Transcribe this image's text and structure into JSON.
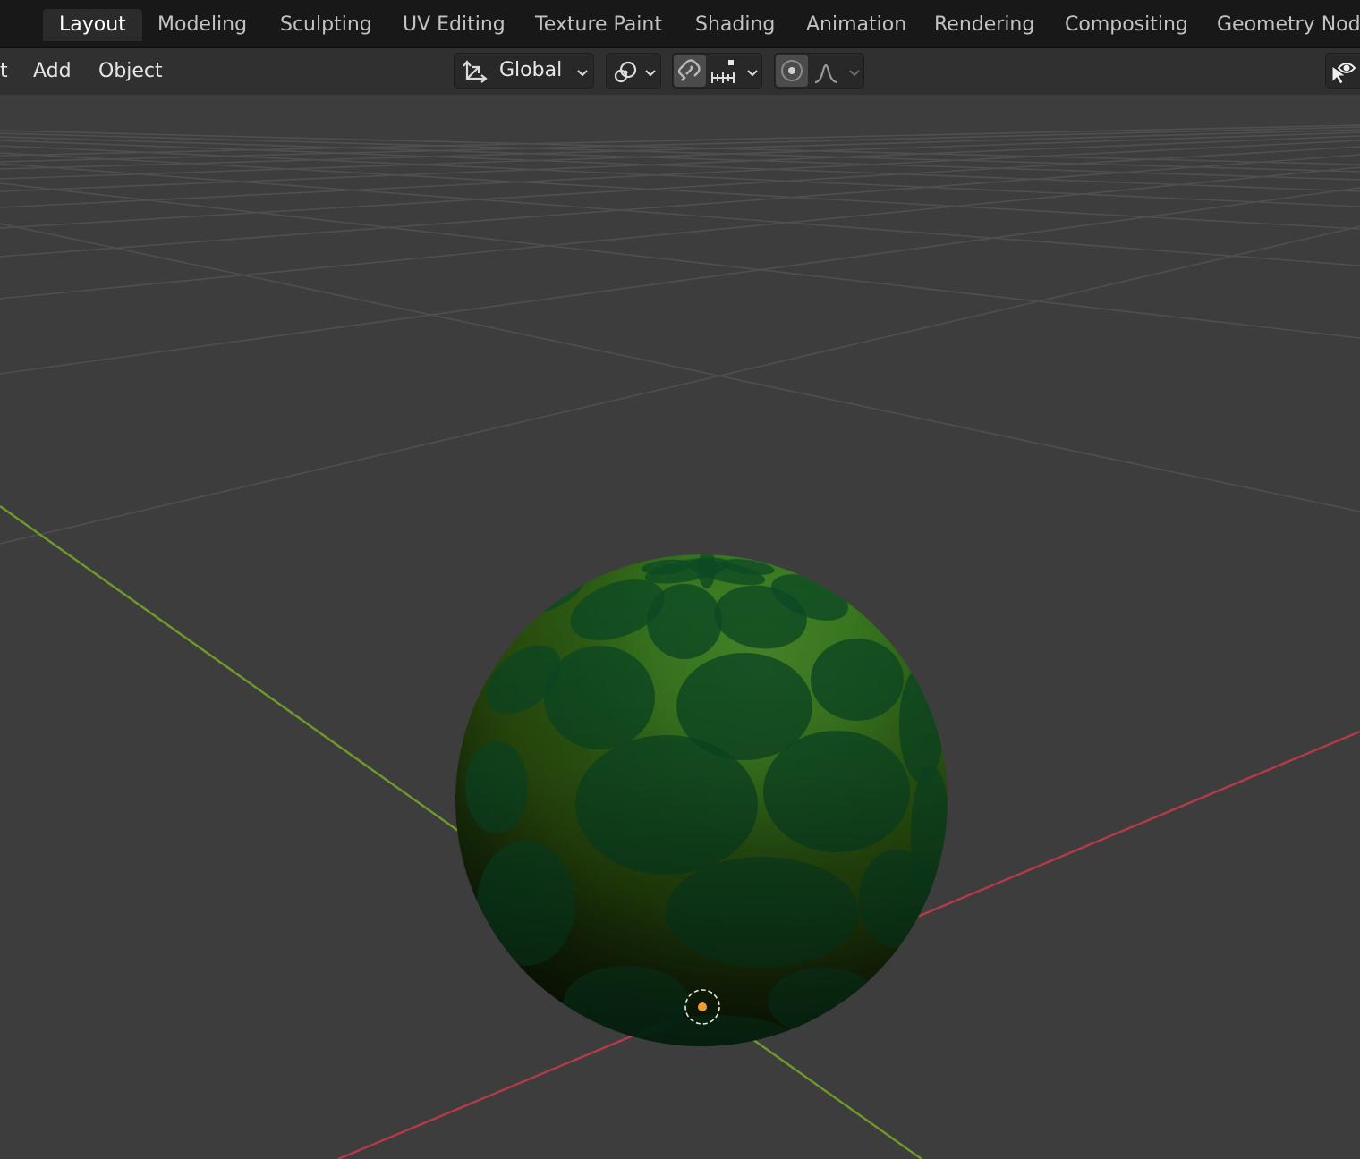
{
  "workspace_tabs": [
    {
      "label": "Layout",
      "active": true
    },
    {
      "label": "Modeling",
      "active": false
    },
    {
      "label": "Sculpting",
      "active": false
    },
    {
      "label": "UV Editing",
      "active": false
    },
    {
      "label": "Texture Paint",
      "active": false
    },
    {
      "label": "Shading",
      "active": false
    },
    {
      "label": "Animation",
      "active": false
    },
    {
      "label": "Rendering",
      "active": false
    },
    {
      "label": "Compositing",
      "active": false
    },
    {
      "label": "Geometry Node",
      "active": false
    }
  ],
  "header": {
    "menu_partial": "t",
    "menu_add": "Add",
    "menu_object": "Object",
    "transform_orientation": "Global",
    "snap_enabled": true,
    "proportional_editing_enabled": false
  },
  "icons": {
    "orientation": "transform-orientation-icon",
    "pivot": "pivot-point-icon",
    "snap": "magnet-snap-icon",
    "snap_target": "snap-increment-icon",
    "proportional": "proportional-editing-icon",
    "falloff": "falloff-curve-icon",
    "visibility": "eye-visibility-icon"
  },
  "colors": {
    "x_axis": "#b53a4a",
    "y_axis": "#6f9a2a",
    "grid": "#4f4f4f",
    "origin": "#f0a030",
    "sphere_base": "#2c5a1a",
    "scale": "#0d4a24"
  }
}
